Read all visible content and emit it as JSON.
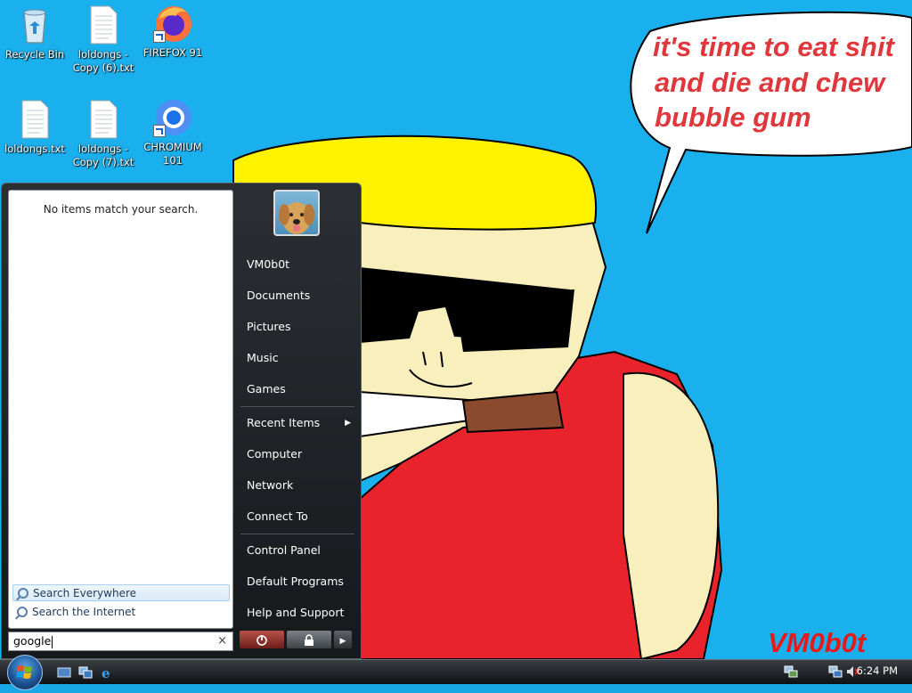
{
  "wallpaper": {
    "speech_lines": [
      "it's time to eat shit",
      "and die and chew",
      "bubble gum"
    ],
    "signature": "VM0b0t"
  },
  "desktop_icons": [
    {
      "label": "Recycle Bin",
      "icon": "recycle-bin-icon"
    },
    {
      "label": "loldongs -\nCopy (6).txt",
      "icon": "text-file-icon"
    },
    {
      "label": "FIREFOX 91",
      "icon": "firefox-icon"
    },
    {
      "label": "loldongs.txt",
      "icon": "text-file-icon"
    },
    {
      "label": "loldongs -\nCopy (7).txt",
      "icon": "text-file-icon"
    },
    {
      "label": "CHROMIUM\n101",
      "icon": "chromium-icon"
    }
  ],
  "start_menu": {
    "no_results": "No items match your search.",
    "search_everywhere": "Search Everywhere",
    "search_internet": "Search the Internet",
    "search_value": "google",
    "clear": "×",
    "right_items": {
      "user": "VM0b0t",
      "documents": "Documents",
      "pictures": "Pictures",
      "music": "Music",
      "games": "Games",
      "recent": "Recent Items",
      "computer": "Computer",
      "network": "Network",
      "connect": "Connect To",
      "control_panel": "Control Panel",
      "default_programs": "Default Programs",
      "help": "Help and Support"
    }
  },
  "taskbar": {
    "clock": "6:24 PM"
  },
  "colors": {
    "desktop": "#1ab0ee",
    "speech_text": "#e0373c",
    "shirt": "#e8232b",
    "hat": "#fff200"
  }
}
